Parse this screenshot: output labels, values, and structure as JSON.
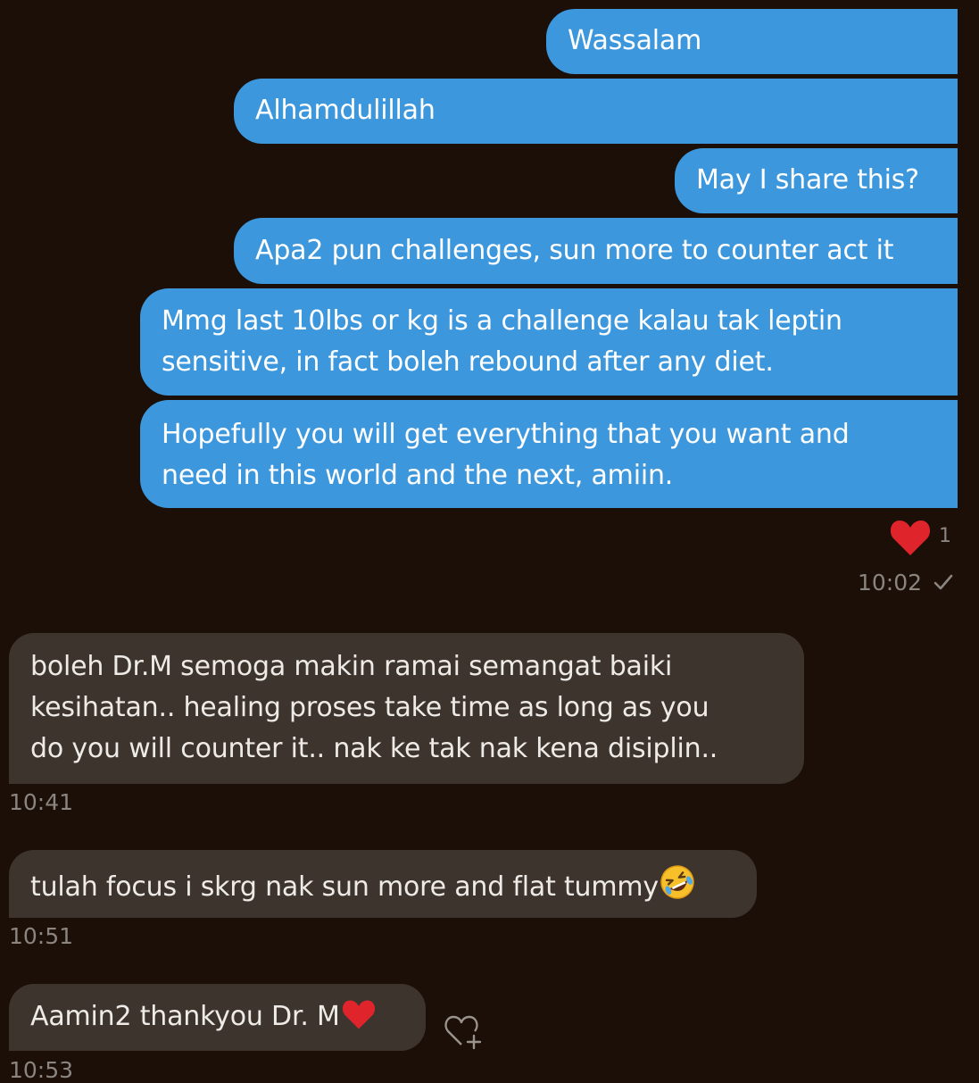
{
  "colors": {
    "background": "#1c0f07",
    "outgoing_bubble": "#3c97dd",
    "incoming_bubble": "#3e342e",
    "heart": "#e0242b",
    "timestamp": "#8a8580"
  },
  "outgoing_messages": [
    {
      "lines": [
        "Wassalam"
      ]
    },
    {
      "lines": [
        "Alhamdulillah"
      ]
    },
    {
      "lines": [
        "May I share this?"
      ]
    },
    {
      "lines": [
        "Apa2 pun challenges, sun more to counter act it"
      ]
    },
    {
      "lines": [
        "Mmg last 10lbs or kg is a challenge kalau tak leptin",
        "sensitive, in fact boleh rebound after any diet."
      ]
    },
    {
      "lines": [
        "Hopefully you will get everything that you want and",
        "need in this world and the next, amiin."
      ]
    }
  ],
  "reaction": {
    "icon": "heart-icon",
    "count": "1"
  },
  "outgoing_time": "10:02",
  "read_receipt_icon": "checkmark-icon",
  "incoming_messages": [
    {
      "lines": [
        "boleh Dr.M semoga makin ramai semangat baiki",
        "kesihatan.. healing proses take time as long as you",
        "do you will counter it.. nak ke tak nak kena disiplin.."
      ],
      "time": "10:41"
    },
    {
      "lines": [
        "tulah focus i skrg nak sun more and flat tummy"
      ],
      "emoji": "rolling-on-floor-laughing-emoji",
      "time": "10:51"
    },
    {
      "lines": [
        "Aamin2 thankyou Dr. M"
      ],
      "emoji": "red-heart-emoji",
      "time": "10:53"
    }
  ],
  "add_reaction_icon": "heart-plus-icon"
}
